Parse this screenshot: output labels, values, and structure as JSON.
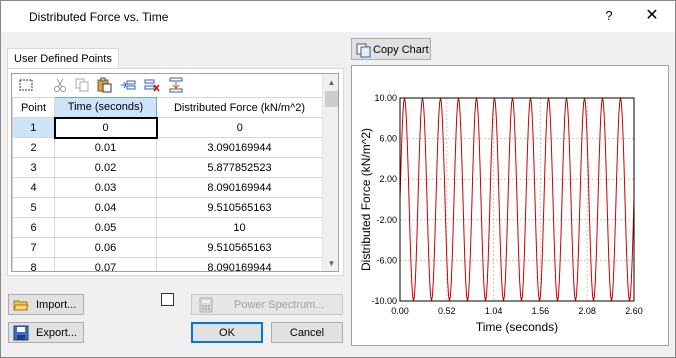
{
  "window": {
    "title": "Distributed Force vs. Time",
    "help_label": "?",
    "close_label": "✕"
  },
  "tab": {
    "label": "User Defined Points"
  },
  "toolbar_icons": [
    "select-all-icon",
    "cut-icon",
    "copy-icon",
    "paste-icon",
    "insert-row-icon",
    "delete-row-icon",
    "append-row-icon"
  ],
  "grid": {
    "headers": [
      "Point",
      "Time (seconds)",
      "Distributed Force (kN/m^2)"
    ],
    "rows": [
      [
        "1",
        "0",
        "0"
      ],
      [
        "2",
        "0.01",
        "3.090169944"
      ],
      [
        "3",
        "0.02",
        "5.877852523"
      ],
      [
        "4",
        "0.03",
        "8.090169944"
      ],
      [
        "5",
        "0.04",
        "9.510565163"
      ],
      [
        "6",
        "0.05",
        "10"
      ],
      [
        "7",
        "0.06",
        "9.510565163"
      ],
      [
        "8",
        "0.07",
        "8.090169944"
      ]
    ]
  },
  "buttons": {
    "copy_chart": "Copy Chart",
    "import": "Import...",
    "export": "Export...",
    "power_spectrum": "Power Spectrum...",
    "ok": "OK",
    "cancel": "Cancel"
  },
  "checkbox": {
    "checked": false
  },
  "chart_data": {
    "type": "line",
    "xlabel": "Time (seconds)",
    "ylabel": "Distributed Force (kN/m^2)",
    "xlim": [
      0,
      2.6
    ],
    "ylim": [
      -10,
      10
    ],
    "xticks": [
      "0.00",
      "0.52",
      "1.04",
      "1.56",
      "2.08",
      "2.60"
    ],
    "yticks": [
      "10.00",
      "6.00",
      "2.00",
      "-2.00",
      "-6.00",
      "-10.00"
    ],
    "grid": true,
    "series": [
      {
        "color": "#cc0000",
        "function": "10*sin(2*pi*5*t)",
        "period": 0.2,
        "amplitude": 10,
        "sample_step": 0.01,
        "x_start": 0,
        "x_end": 2.6
      }
    ]
  },
  "colors": {
    "accent": "#0078d7",
    "series": "#cc0000",
    "selected_header": "#cce4f7"
  }
}
